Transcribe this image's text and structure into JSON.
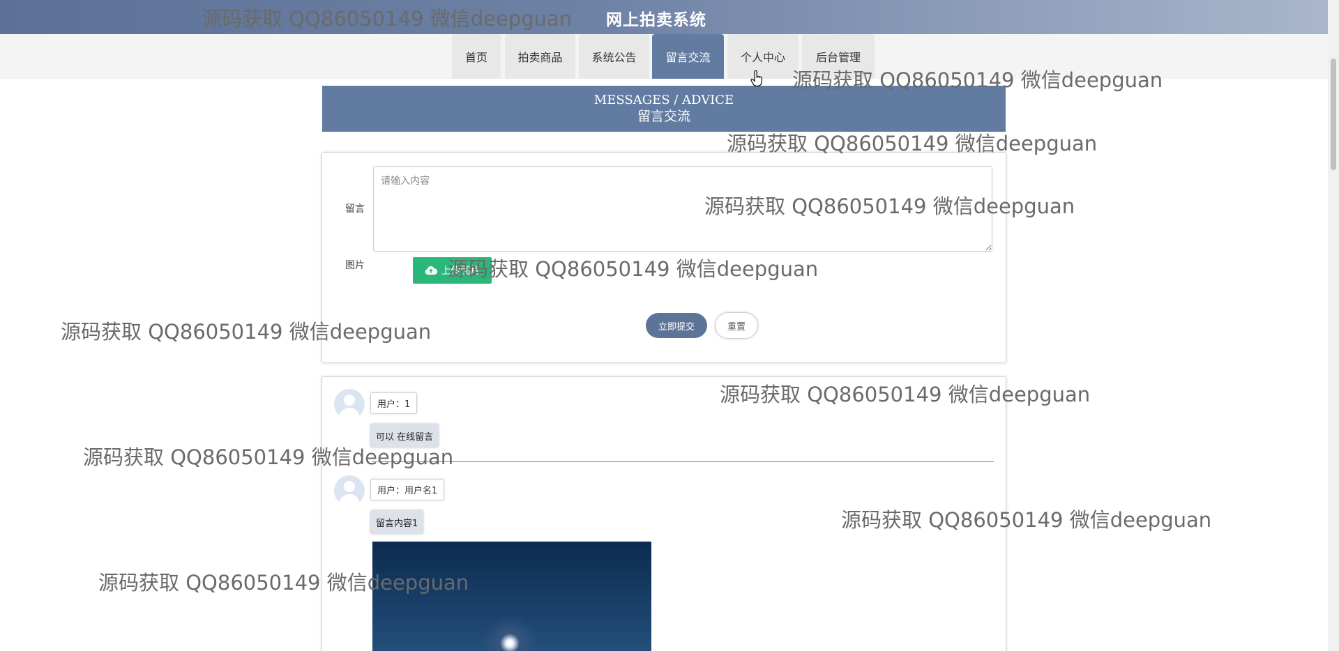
{
  "header": {
    "title": "网上拍卖系统"
  },
  "nav": {
    "tabs": [
      {
        "label": "首页"
      },
      {
        "label": "拍卖商品"
      },
      {
        "label": "系统公告"
      },
      {
        "label": "留言交流"
      },
      {
        "label": "个人中心"
      },
      {
        "label": "后台管理"
      }
    ],
    "active_index": 3
  },
  "banner": {
    "title_en": "MESSAGES / ADVICE",
    "title_cn": "留言交流"
  },
  "form": {
    "message_label": "留言",
    "message_placeholder": "请输入内容",
    "image_label": "图片",
    "upload_label": "上传图片",
    "upload_icon": "cloud-upload-icon",
    "submit_label": "立即提交",
    "reset_label": "重置"
  },
  "messages": [
    {
      "user": "用户：1",
      "content": "可以 在线留言"
    },
    {
      "user": "用户：用户名1",
      "content": "留言内容1"
    }
  ],
  "watermark": {
    "text": "源码获取 QQ86050149 微信deepguan"
  },
  "colors": {
    "primary": "#617ba1",
    "upload": "#2bb67a"
  }
}
